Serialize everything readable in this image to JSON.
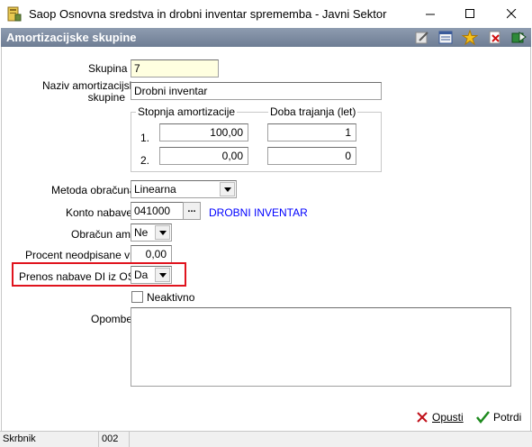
{
  "window": {
    "title": "Saop Osnovna sredstva in drobni inventar sprememba - Javni Sektor"
  },
  "header": {
    "title": "Amortizacijske skupine",
    "toolbar_icons": [
      "edit-icon",
      "form-list-icon",
      "star-icon",
      "delete-icon",
      "exit-book-icon"
    ]
  },
  "form": {
    "skupina": {
      "label": "Skupina",
      "value": "7"
    },
    "naziv": {
      "label_line1": "Naziv amortizacijske",
      "label_line2": "skupine",
      "value": "Drobni inventar"
    },
    "group_stopnja": {
      "title": "Stopnja amortizacije"
    },
    "group_doba": {
      "title": "Doba trajanja (let)"
    },
    "rows": [
      {
        "num": "1.",
        "stopnja": "100,00",
        "doba": "1"
      },
      {
        "num": "2.",
        "stopnja": "0,00",
        "doba": "0"
      }
    ],
    "metoda": {
      "label": "Metoda obračuna",
      "value": "Linearna"
    },
    "konto": {
      "label": "Konto nabave",
      "value": "041000",
      "button": "...",
      "description": "DROBNI INVENTAR"
    },
    "obracun": {
      "label": "Obračun am.",
      "value": "Ne"
    },
    "procent": {
      "label": "Procent neodpisane vr.",
      "value": "0,00"
    },
    "prenos": {
      "label": "Prenos nabave DI iz OSD",
      "value": "Da"
    },
    "neaktivno": {
      "label": "Neaktivno",
      "checked": false
    },
    "opombe": {
      "label": "Opombe",
      "value": ""
    }
  },
  "buttons": {
    "opusti": "Opusti",
    "potrdi": "Potrdi"
  },
  "status": {
    "user": "Skrbnik",
    "code": "002"
  },
  "colors": {
    "header_bg": "#7f8da3",
    "link_blue": "#0000ff",
    "highlight_red": "#e0141e",
    "key_field_bg": "#ffffe0"
  }
}
